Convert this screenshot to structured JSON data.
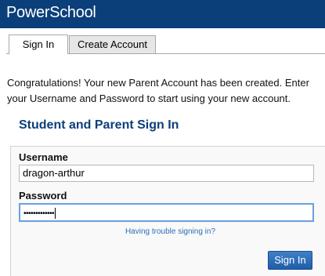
{
  "header": {
    "logo_text": "PowerSchool",
    "brand_color": "#0b3f7a"
  },
  "tabs": [
    {
      "label": "Sign In",
      "active": true
    },
    {
      "label": "Create Account",
      "active": false
    }
  ],
  "message": "Congratulations! Your new Parent Account has been created. Enter your Username and Password to start using your new account.",
  "form": {
    "title": "Student and Parent Sign In",
    "username_label": "Username",
    "username_value": "dragon-arthur",
    "password_label": "Password",
    "password_masked": "•••••••••••••",
    "trouble_link": "Having trouble signing in?",
    "submit_label": "Sign In",
    "link_color": "#2a6eb8"
  }
}
